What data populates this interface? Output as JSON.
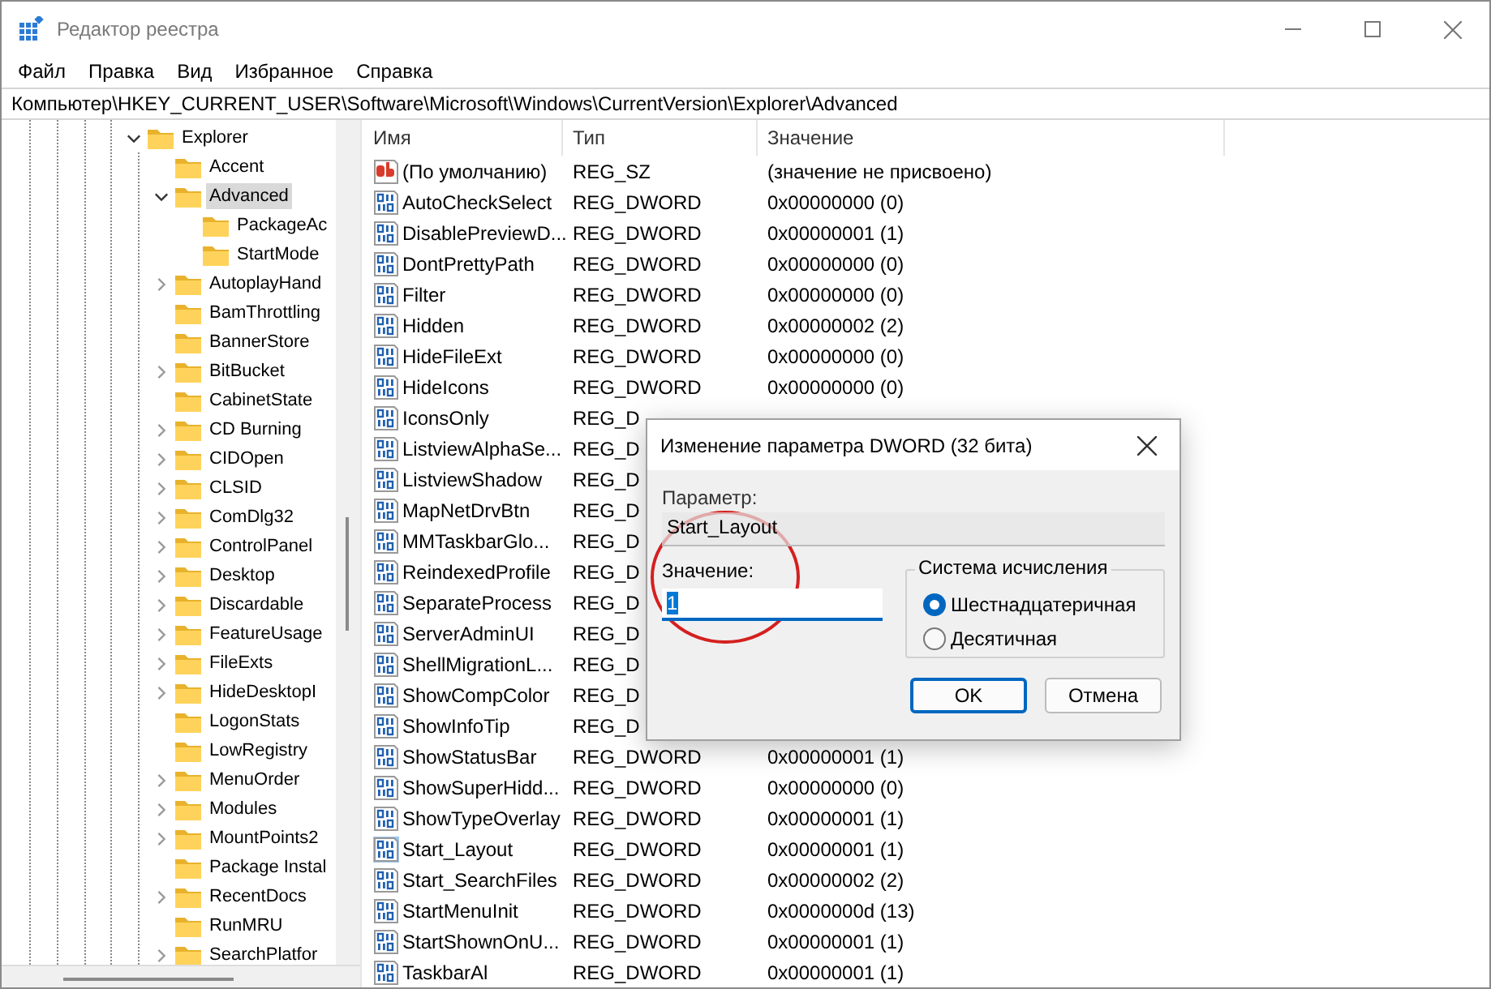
{
  "window": {
    "title": "Редактор реестра"
  },
  "menu": [
    "Файл",
    "Правка",
    "Вид",
    "Избранное",
    "Справка"
  ],
  "address": "Компьютер\\HKEY_CURRENT_USER\\Software\\Microsoft\\Windows\\CurrentVersion\\Explorer\\Advanced",
  "tree": [
    {
      "label": "Explorer",
      "expandable": true,
      "expanded": true,
      "selected": false,
      "children": [
        {
          "label": "Accent",
          "expandable": false,
          "selected": false
        },
        {
          "label": "Advanced",
          "expandable": true,
          "expanded": true,
          "selected": true,
          "children": [
            {
              "label": "PackageAc",
              "expandable": false,
              "selected": false
            },
            {
              "label": "StartMode",
              "expandable": false,
              "selected": false
            }
          ]
        },
        {
          "label": "AutoplayHand",
          "expandable": true,
          "expanded": false,
          "selected": false
        },
        {
          "label": "BamThrottling",
          "expandable": false,
          "selected": false
        },
        {
          "label": "BannerStore",
          "expandable": false,
          "selected": false
        },
        {
          "label": "BitBucket",
          "expandable": true,
          "expanded": false,
          "selected": false
        },
        {
          "label": "CabinetState",
          "expandable": false,
          "selected": false
        },
        {
          "label": "CD Burning",
          "expandable": true,
          "expanded": false,
          "selected": false
        },
        {
          "label": "CIDOpen",
          "expandable": true,
          "expanded": false,
          "selected": false
        },
        {
          "label": "CLSID",
          "expandable": true,
          "expanded": false,
          "selected": false
        },
        {
          "label": "ComDlg32",
          "expandable": true,
          "expanded": false,
          "selected": false
        },
        {
          "label": "ControlPanel",
          "expandable": true,
          "expanded": false,
          "selected": false
        },
        {
          "label": "Desktop",
          "expandable": true,
          "expanded": false,
          "selected": false
        },
        {
          "label": "Discardable",
          "expandable": true,
          "expanded": false,
          "selected": false
        },
        {
          "label": "FeatureUsage",
          "expandable": true,
          "expanded": false,
          "selected": false
        },
        {
          "label": "FileExts",
          "expandable": true,
          "expanded": false,
          "selected": false
        },
        {
          "label": "HideDesktopI",
          "expandable": true,
          "expanded": false,
          "selected": false
        },
        {
          "label": "LogonStats",
          "expandable": false,
          "selected": false
        },
        {
          "label": "LowRegistry",
          "expandable": false,
          "selected": false
        },
        {
          "label": "MenuOrder",
          "expandable": true,
          "expanded": false,
          "selected": false
        },
        {
          "label": "Modules",
          "expandable": true,
          "expanded": false,
          "selected": false
        },
        {
          "label": "MountPoints2",
          "expandable": true,
          "expanded": false,
          "selected": false
        },
        {
          "label": "Package Instal",
          "expandable": false,
          "selected": false
        },
        {
          "label": "RecentDocs",
          "expandable": true,
          "expanded": false,
          "selected": false
        },
        {
          "label": "RunMRU",
          "expandable": false,
          "selected": false
        },
        {
          "label": "SearchPlatfor",
          "expandable": true,
          "expanded": false,
          "selected": false
        }
      ]
    }
  ],
  "table": {
    "columns": [
      "Имя",
      "Тип",
      "Значение"
    ],
    "rows": [
      {
        "kind": "string",
        "name": "(По умолчанию)",
        "type": "REG_SZ",
        "value": "(значение не присвоено)",
        "selected": false
      },
      {
        "kind": "dword",
        "name": "AutoCheckSelect",
        "type": "REG_DWORD",
        "value": "0x00000000 (0)",
        "selected": false
      },
      {
        "kind": "dword",
        "name": "DisablePreviewD...",
        "type": "REG_DWORD",
        "value": "0x00000001 (1)",
        "selected": false
      },
      {
        "kind": "dword",
        "name": "DontPrettyPath",
        "type": "REG_DWORD",
        "value": "0x00000000 (0)",
        "selected": false
      },
      {
        "kind": "dword",
        "name": "Filter",
        "type": "REG_DWORD",
        "value": "0x00000000 (0)",
        "selected": false
      },
      {
        "kind": "dword",
        "name": "Hidden",
        "type": "REG_DWORD",
        "value": "0x00000002 (2)",
        "selected": false
      },
      {
        "kind": "dword",
        "name": "HideFileExt",
        "type": "REG_DWORD",
        "value": "0x00000000 (0)",
        "selected": false
      },
      {
        "kind": "dword",
        "name": "HideIcons",
        "type": "REG_DWORD",
        "value": "0x00000000 (0)",
        "selected": false
      },
      {
        "kind": "dword",
        "name": "IconsOnly",
        "type": "REG_D",
        "selected": false
      },
      {
        "kind": "dword",
        "name": "ListviewAlphaSe...",
        "type": "REG_D",
        "selected": false
      },
      {
        "kind": "dword",
        "name": "ListviewShadow",
        "type": "REG_D",
        "selected": false
      },
      {
        "kind": "dword",
        "name": "MapNetDrvBtn",
        "type": "REG_D",
        "selected": false
      },
      {
        "kind": "dword",
        "name": "MMTaskbarGlo...",
        "type": "REG_D",
        "selected": false
      },
      {
        "kind": "dword",
        "name": "ReindexedProfile",
        "type": "REG_D",
        "selected": false
      },
      {
        "kind": "dword",
        "name": "SeparateProcess",
        "type": "REG_D",
        "selected": false
      },
      {
        "kind": "dword",
        "name": "ServerAdminUI",
        "type": "REG_D",
        "selected": false
      },
      {
        "kind": "dword",
        "name": "ShellMigrationL...",
        "type": "REG_D",
        "selected": false
      },
      {
        "kind": "dword",
        "name": "ShowCompColor",
        "type": "REG_D",
        "selected": false
      },
      {
        "kind": "dword",
        "name": "ShowInfoTip",
        "type": "REG_D",
        "selected": false
      },
      {
        "kind": "dword",
        "name": "ShowStatusBar",
        "type": "REG_DWORD",
        "value": "0x00000001 (1)",
        "selected": false
      },
      {
        "kind": "dword",
        "name": "ShowSuperHidd...",
        "type": "REG_DWORD",
        "value": "0x00000000 (0)",
        "selected": false
      },
      {
        "kind": "dword",
        "name": "ShowTypeOverlay",
        "type": "REG_DWORD",
        "value": "0x00000001 (1)",
        "selected": false
      },
      {
        "kind": "dword",
        "name": "Start_Layout",
        "type": "REG_DWORD",
        "value": "0x00000001 (1)",
        "selected": true
      },
      {
        "kind": "dword",
        "name": "Start_SearchFiles",
        "type": "REG_DWORD",
        "value": "0x00000002 (2)",
        "selected": false
      },
      {
        "kind": "dword",
        "name": "StartMenuInit",
        "type": "REG_DWORD",
        "value": "0x0000000d (13)",
        "selected": false
      },
      {
        "kind": "dword",
        "name": "StartShownOnU...",
        "type": "REG_DWORD",
        "value": "0x00000001 (1)",
        "selected": false
      },
      {
        "kind": "dword",
        "name": "TaskbarAl",
        "type": "REG_DWORD",
        "value": "0x00000001 (1)",
        "selected": false
      }
    ]
  },
  "dialog": {
    "title": "Изменение параметра DWORD (32 бита)",
    "param_label": "Параметр:",
    "param_value": "Start_Layout",
    "value_label": "Значение:",
    "value": "1",
    "base_label": "Система исчисления",
    "bases": [
      {
        "label": "Шестнадцатеричная",
        "selected": true
      },
      {
        "label": "Десятичная",
        "selected": false
      }
    ],
    "buttons": [
      {
        "label": "OK",
        "default": true
      },
      {
        "label": "Отмена",
        "default": false
      }
    ]
  }
}
